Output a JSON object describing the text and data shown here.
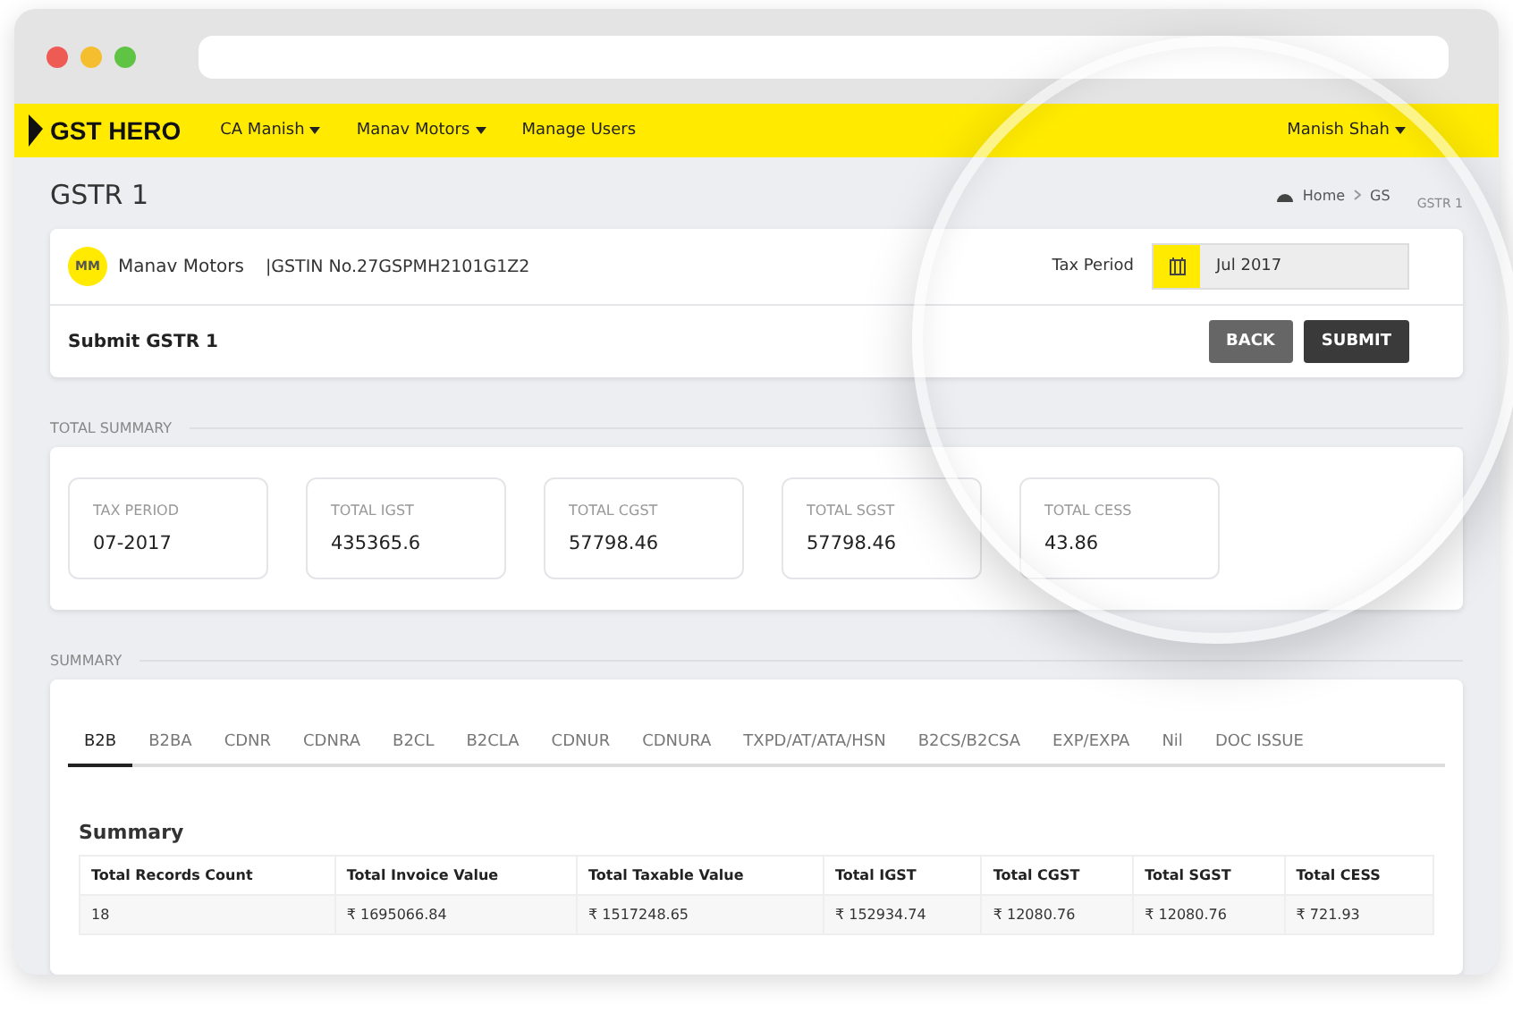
{
  "nav": {
    "logo": "GST HERO",
    "menus": [
      {
        "label": "CA Manish",
        "dropdown": true
      },
      {
        "label": "Manav Motors",
        "dropdown": true
      },
      {
        "label": "Manage Users",
        "dropdown": false
      }
    ],
    "user": "Manish Shah"
  },
  "page_title": "GSTR 1",
  "breadcrumb": [
    "Home",
    "GS"
  ],
  "breadcrumb_tail": "GSTR 1",
  "business": {
    "initials": "MM",
    "name": "Manav Motors",
    "gstin": "|GSTIN No.27GSPMH2101G1Z2"
  },
  "tax_period": {
    "label": "Tax Period",
    "value": "Jul 2017"
  },
  "submit_heading": "Submit GSTR 1",
  "buttons": [
    {
      "label": "BACK",
      "kind": "secondary"
    },
    {
      "label": "SUBMIT",
      "kind": "primary"
    }
  ],
  "total_summary": {
    "heading": "TOTAL SUMMARY",
    "cards": [
      {
        "label": "TAX PERIOD",
        "value": "07-2017"
      },
      {
        "label": "TOTAL IGST",
        "value": "435365.6"
      },
      {
        "label": "TOTAL CGST",
        "value": "57798.46"
      },
      {
        "label": "TOTAL SGST",
        "value": "57798.46"
      },
      {
        "label": "TOTAL CESS",
        "value": "43.86"
      }
    ]
  },
  "summary": {
    "heading": "SUMMARY",
    "tabs": [
      {
        "label": "B2B",
        "selected": true
      },
      {
        "label": "B2BA",
        "selected": false
      },
      {
        "label": "CDNR",
        "selected": false
      },
      {
        "label": "CDNRA",
        "selected": false
      },
      {
        "label": "B2CL",
        "selected": false
      },
      {
        "label": "B2CLA",
        "selected": false
      },
      {
        "label": "CDNUR",
        "selected": false
      },
      {
        "label": "CDNURA",
        "selected": false
      },
      {
        "label": "TXPD/AT/ATA/HSN",
        "selected": false
      },
      {
        "label": "B2CS/B2CSA",
        "selected": false
      },
      {
        "label": "EXP/EXPA",
        "selected": false
      },
      {
        "label": "Nil",
        "selected": false
      },
      {
        "label": "DOC ISSUE",
        "selected": false
      }
    ],
    "table_title": "Summary",
    "table": {
      "columns": [
        "Total Records Count",
        "Total Invoice Value",
        "Total Taxable Value",
        "Total IGST",
        "Total CGST",
        "Total SGST",
        "Total CESS"
      ],
      "rows": [
        [
          "18",
          "₹ 1695066.84",
          "₹ 1517248.65",
          "₹ 152934.74",
          "₹ 12080.76",
          "₹ 12080.76",
          "₹ 721.93"
        ]
      ]
    }
  }
}
